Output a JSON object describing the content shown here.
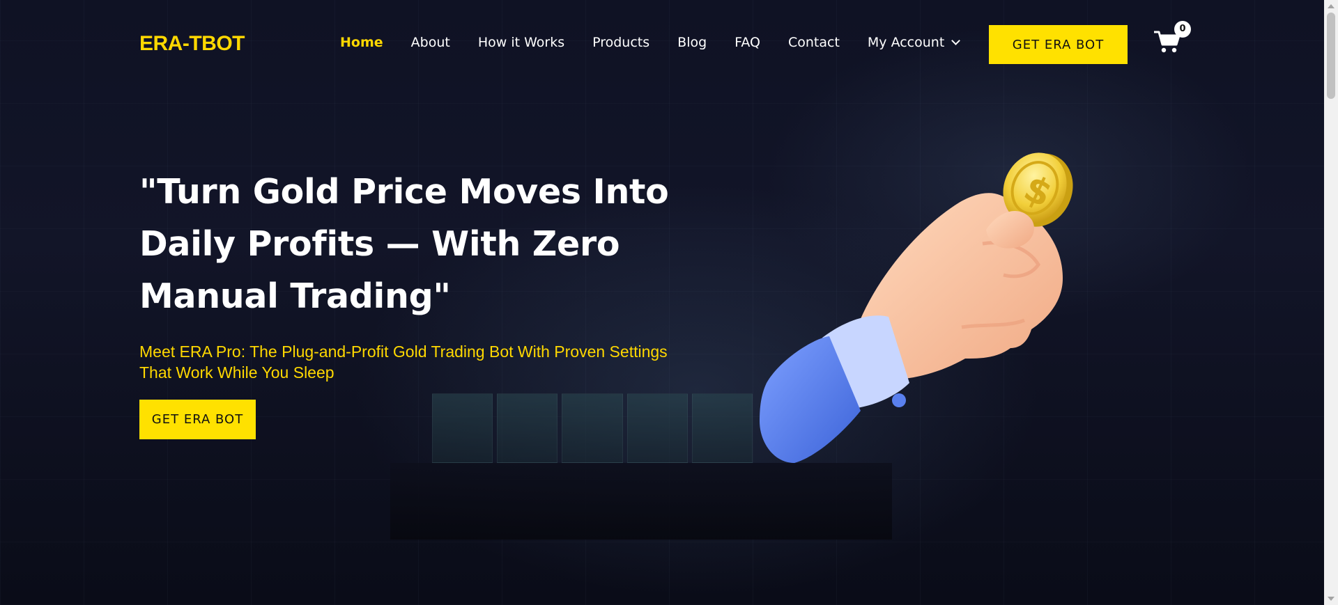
{
  "brand": {
    "logo_text": "ERA-TBOT"
  },
  "nav": {
    "items": [
      {
        "label": "Home",
        "active": true
      },
      {
        "label": "About",
        "active": false
      },
      {
        "label": "How it Works",
        "active": false
      },
      {
        "label": "Products",
        "active": false
      },
      {
        "label": "Blog",
        "active": false
      },
      {
        "label": "FAQ",
        "active": false
      },
      {
        "label": "Contact",
        "active": false
      }
    ],
    "account_label": "My Account",
    "cta_label": "GET ERA BOT",
    "cart_count": "0"
  },
  "hero": {
    "title": "\"Turn Gold Price Moves Into Daily Profits — With Zero Manual Trading\"",
    "subtitle": "Meet ERA Pro: The Plug-and-Profit Gold Trading Bot With Proven Settings That Work While You Sleep",
    "cta_label": "GET ERA BOT"
  },
  "colors": {
    "accent": "#ffd800",
    "button": "#ffe100",
    "background": "#0b0d1c",
    "text": "#ffffff"
  },
  "icons": {
    "cart": "shopping-cart-icon",
    "account_dropdown": "chevron-down-icon",
    "hero_image": "hand-holding-gold-coin"
  }
}
